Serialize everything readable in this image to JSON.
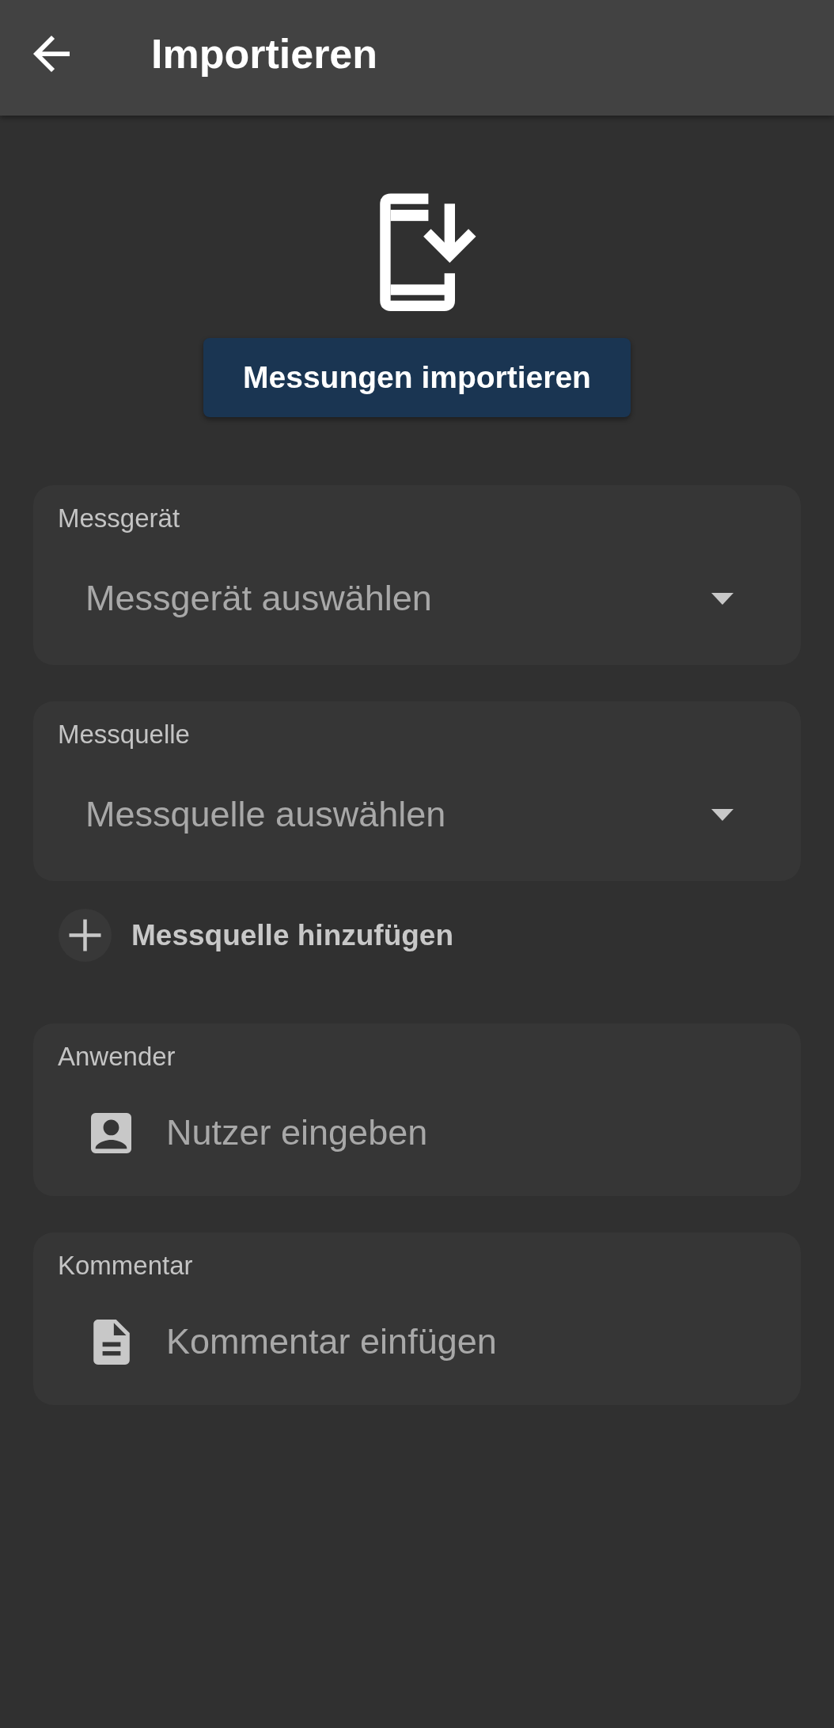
{
  "app_bar": {
    "title": "Importieren"
  },
  "import_button": {
    "label": "Messungen importieren"
  },
  "form": [
    {
      "kind": "select",
      "label": "Messgerät",
      "placeholder": "Messgerät auswählen"
    },
    {
      "kind": "select",
      "label": "Messquelle",
      "placeholder": "Messquelle auswählen"
    },
    {
      "kind": "add",
      "label": "Messquelle hinzufügen"
    },
    {
      "kind": "user",
      "label": "Anwender",
      "placeholder": "Nutzer eingeben"
    },
    {
      "kind": "comment",
      "label": "Kommentar",
      "placeholder": "Kommentar einfügen"
    }
  ]
}
